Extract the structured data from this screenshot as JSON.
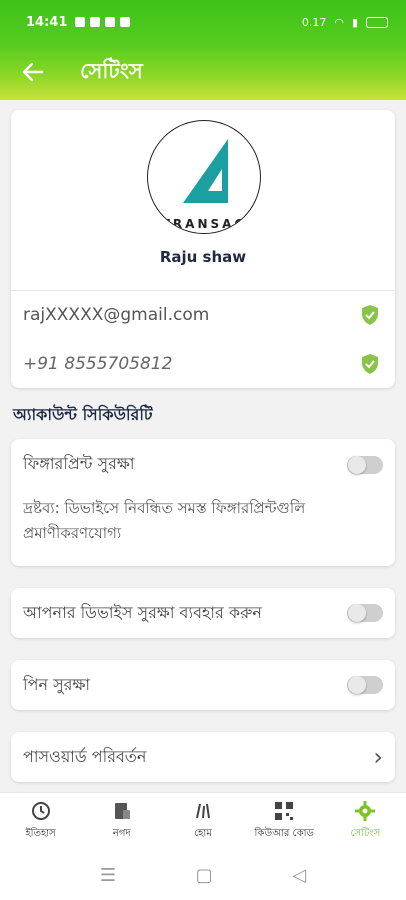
{
  "status_bar": {
    "time": "14:41",
    "network": "0.17",
    "battery_icon": "battery-icon"
  },
  "app_bar": {
    "title": "সেটিংস"
  },
  "profile": {
    "logo_text": "TRANSAC",
    "name": "Raju shaw",
    "email": "rajXXXXX@gmail.com",
    "phone": "+91 8555705812",
    "verified_color": "#8bc34a"
  },
  "security": {
    "section_title": "অ্যাকাউন্ট সিকিউরিটি",
    "fingerprint_label": "ফিঙ্গারপ্রিন্ট সুরক্ষা",
    "fingerprint_enabled": false,
    "fingerprint_note": "দ্রষ্টব্য: ডিভাইসে নিবন্ধিত সমস্ত ফিঙ্গারপ্রিন্টগুলি প্রমাণীকরণযোগ্য",
    "device_security_label": "আপনার ডিভাইস সুরক্ষা ব্যবহার করুন",
    "device_security_enabled": false,
    "pin_label": "পিন সুরক্ষা",
    "pin_enabled": false,
    "password_label": "পাসওয়ার্ড পরিবর্তন"
  },
  "bottom_nav": {
    "items": [
      {
        "label": "ইতিহাস",
        "icon": "history-icon"
      },
      {
        "label": "নগদ",
        "icon": "cash-icon"
      },
      {
        "label": "হোম",
        "icon": "home-icon"
      },
      {
        "label": "কিউআর কোড",
        "icon": "qr-code-icon"
      },
      {
        "label": "সেটিংস",
        "icon": "settings-gear-icon"
      }
    ],
    "active_index": 4,
    "active_color": "#7dc41f"
  },
  "colors": {
    "header_start": "#3fc21a",
    "header_end": "#c9e23a"
  }
}
